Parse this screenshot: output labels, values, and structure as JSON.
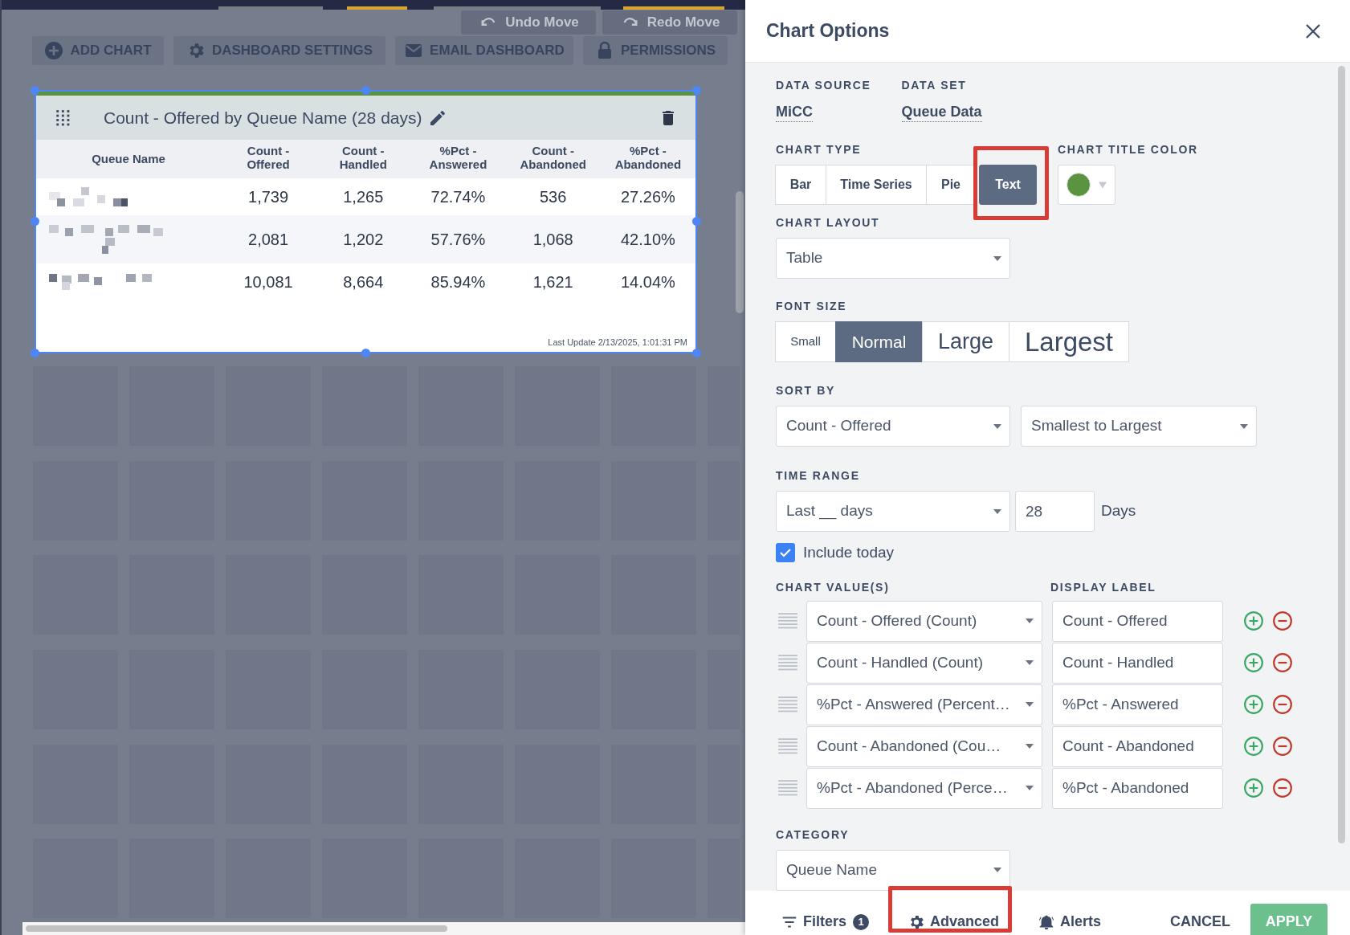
{
  "toolbar": {
    "buttons": [
      {
        "label": "ADD CHART",
        "kind": "plus"
      },
      {
        "label": "DASHBOARD SETTINGS",
        "kind": "gear"
      },
      {
        "label": "EMAIL DASHBOARD",
        "kind": "mail"
      },
      {
        "label": "PERMISSIONS",
        "kind": "lock"
      }
    ]
  },
  "history_buttons": [
    {
      "label": "Undo Move",
      "kind": "undo"
    },
    {
      "label": "Redo Move",
      "kind": "redo"
    }
  ],
  "chart_card": {
    "title": "Count - Offered by Queue Name (28 days)",
    "table": {
      "columns": [
        "Queue Name",
        "Count - Offered",
        "Count - Handled",
        "%Pct - Answered",
        "Count - Abandoned",
        "%Pct - Abandoned"
      ],
      "rows": [
        {
          "cells": [
            "",
            "1,739",
            "1,265",
            "72.74%",
            "536",
            "27.26%"
          ]
        },
        {
          "cells": [
            "",
            "2,081",
            "1,202",
            "57.76%",
            "1,068",
            "42.10%"
          ]
        },
        {
          "cells": [
            "",
            "10,081",
            "8,664",
            "85.94%",
            "1,621",
            "14.04%"
          ]
        }
      ]
    },
    "last_update": "Last Update 2/13/2025, 1:01:31 PM"
  },
  "panel": {
    "title": "Chart Options",
    "data_source": {
      "label": "DATA SOURCE",
      "value": "MiCC"
    },
    "data_set": {
      "label": "DATA SET",
      "value": "Queue Data"
    },
    "chart_type": {
      "label": "CHART TYPE",
      "options": [
        {
          "label": "Bar",
          "selected": false
        },
        {
          "label": "Time Series",
          "selected": false
        },
        {
          "label": "Pie",
          "selected": false
        },
        {
          "label": "Text",
          "selected": true
        }
      ]
    },
    "chart_title_color": {
      "label": "CHART TITLE COLOR",
      "color": "#5a9440"
    },
    "chart_layout": {
      "label": "CHART LAYOUT",
      "value": "Table"
    },
    "font_size": {
      "label": "FONT SIZE",
      "options": [
        {
          "label": "Small",
          "selected": false
        },
        {
          "label": "Normal",
          "selected": true
        },
        {
          "label": "Large",
          "selected": false
        },
        {
          "label": "Largest",
          "selected": false
        }
      ]
    },
    "sort_by": {
      "label": "SORT BY",
      "field": "Count - Offered",
      "order": "Smallest to Largest"
    },
    "time_range": {
      "label": "TIME RANGE",
      "preset": "Last __ days",
      "days": "28",
      "unit": "Days"
    },
    "include_today": {
      "label": "Include today",
      "checked": true
    },
    "chart_values": {
      "label": "CHART VALUE(S)",
      "display_label_heading": "DISPLAY LABEL",
      "rows": [
        {
          "value": "Count - Offered (Count)",
          "display_label": "Count - Offered"
        },
        {
          "value": "Count - Handled (Count)",
          "display_label": "Count - Handled"
        },
        {
          "value": "%Pct - Answered (Percent…",
          "display_label": "%Pct - Answered"
        },
        {
          "value": "Count - Abandoned (Cou…",
          "display_label": "Count - Abandoned"
        },
        {
          "value": "%Pct - Abandoned (Perce…",
          "display_label": "%Pct - Abandoned"
        }
      ]
    },
    "category": {
      "label": "CATEGORY",
      "value": "Queue Name"
    },
    "footer": {
      "tabs": [
        {
          "label": "Filters",
          "kind": "filter",
          "badge": "1"
        },
        {
          "label": "Advanced",
          "kind": "gear"
        },
        {
          "label": "Alerts",
          "kind": "bell"
        }
      ],
      "cancel": "CANCEL",
      "apply": "APPLY"
    }
  }
}
